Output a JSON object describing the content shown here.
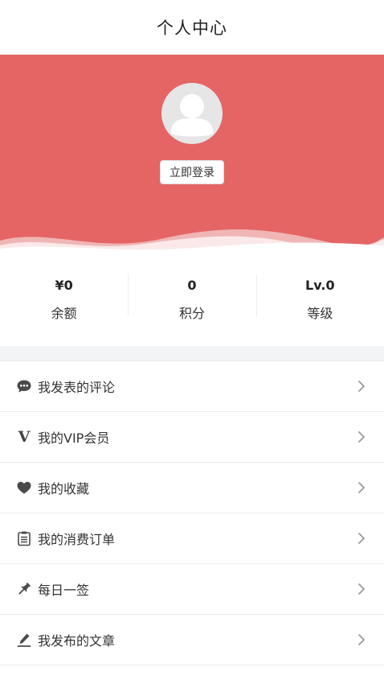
{
  "header": {
    "title": "个人中心"
  },
  "profile": {
    "login_label": "立即登录"
  },
  "colors": {
    "brand": "#e56565",
    "icon": "#4a4a4a",
    "chevron": "#999999"
  },
  "stats": [
    {
      "value": "¥0",
      "label": "余额"
    },
    {
      "value": "0",
      "label": "积分"
    },
    {
      "value": "Lv.0",
      "label": "等级"
    }
  ],
  "menu": [
    {
      "label": "我发表的评论",
      "icon": "comment-icon"
    },
    {
      "label": "我的VIP会员",
      "icon": "vip-icon"
    },
    {
      "label": "我的收藏",
      "icon": "heart-icon"
    },
    {
      "label": "我的消费订单",
      "icon": "clipboard-icon"
    },
    {
      "label": "每日一签",
      "icon": "pin-icon"
    },
    {
      "label": "我发布的文章",
      "icon": "edit-icon"
    }
  ]
}
